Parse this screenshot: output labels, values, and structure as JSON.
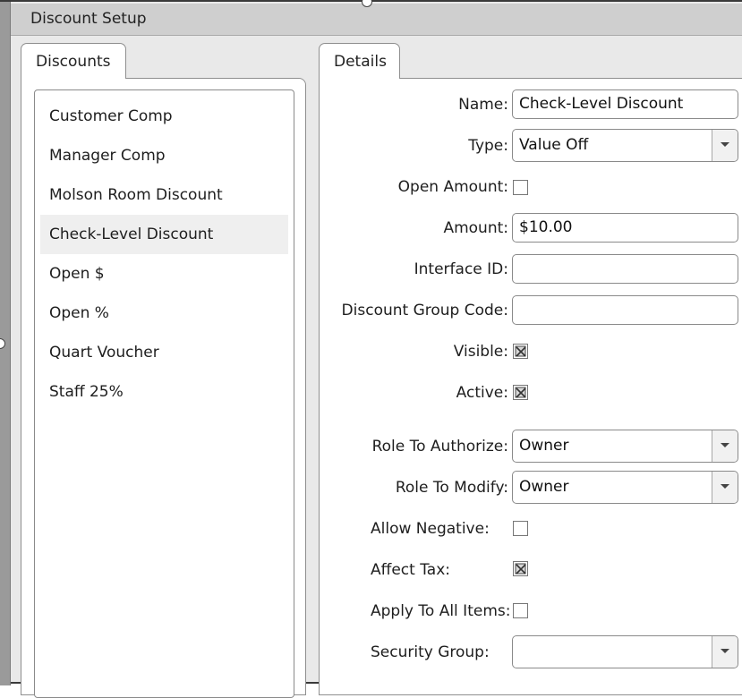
{
  "window": {
    "title": "Discount Setup"
  },
  "tabs": {
    "discounts": "Discounts",
    "details": "Details"
  },
  "discount_list": [
    "Customer Comp",
    "Manager Comp",
    "Molson Room Discount",
    "Check-Level Discount",
    "Open $",
    "Open %",
    "Quart Voucher",
    "Staff 25%"
  ],
  "selected_index": 3,
  "details": {
    "name_label": "Name:",
    "name_value": "Check-Level Discount",
    "type_label": "Type:",
    "type_value": "Value Off",
    "open_amount_label": "Open Amount:",
    "open_amount_checked": false,
    "amount_label": "Amount:",
    "amount_value": "$10.00",
    "interface_id_label": "Interface ID:",
    "interface_id_value": "",
    "discount_group_code_label": "Discount Group Code:",
    "discount_group_code_value": "",
    "visible_label": "Visible:",
    "visible_checked": true,
    "active_label": "Active:",
    "active_checked": true,
    "role_authorize_label": "Role To Authorize:",
    "role_authorize_value": "Owner",
    "role_modify_label": "Role To Modify:",
    "role_modify_value": "Owner",
    "allow_negative_label": "Allow Negative:",
    "allow_negative_checked": false,
    "affect_tax_label": "Affect Tax:",
    "affect_tax_checked": true,
    "apply_all_label": "Apply To All Items:",
    "apply_all_checked": false,
    "security_group_label": "Security Group:",
    "security_group_value": ""
  },
  "icons": {
    "dropdown": "chevron-down-icon",
    "checkbox": "checkbox-x-icon"
  }
}
